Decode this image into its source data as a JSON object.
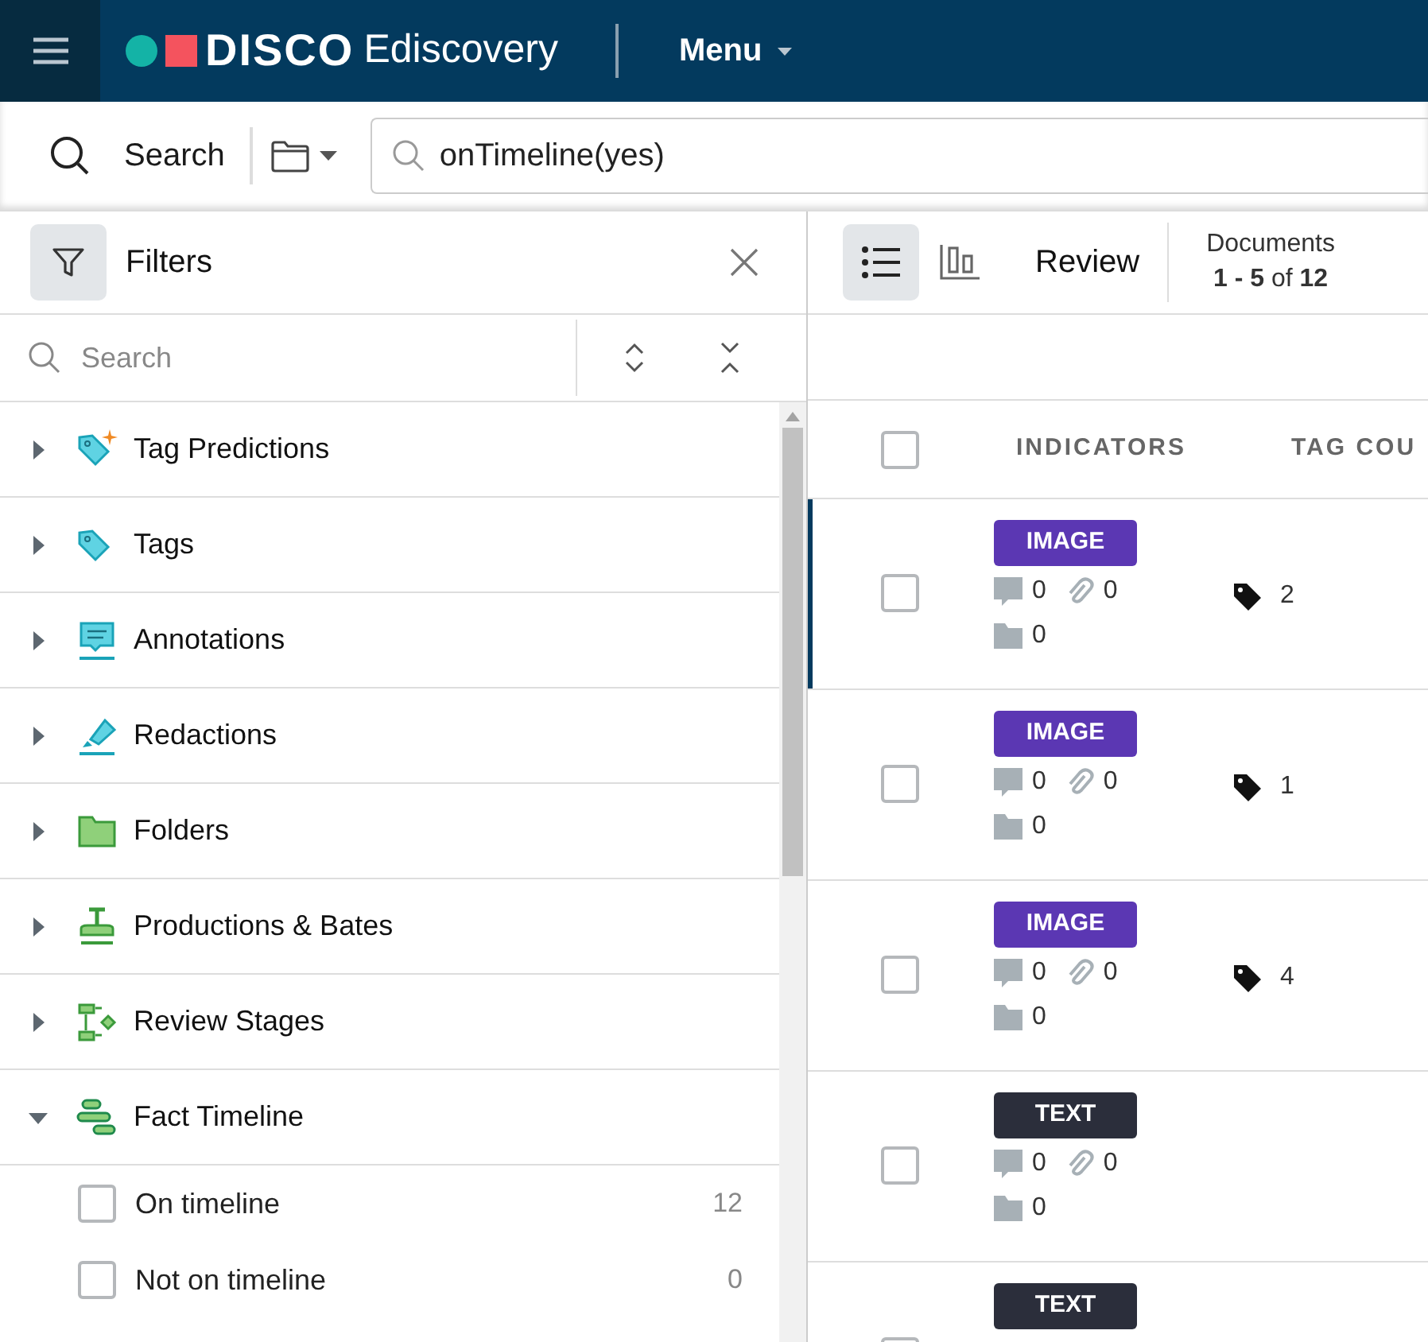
{
  "header": {
    "logo_text": "DISCO",
    "product": "Ediscovery",
    "menu": "Menu"
  },
  "search_bar": {
    "label": "Search",
    "query": "onTimeline(yes)"
  },
  "filters": {
    "title": "Filters",
    "search_placeholder": "Search",
    "categories": [
      {
        "label": "Tag Predictions",
        "expanded": false
      },
      {
        "label": "Tags",
        "expanded": false
      },
      {
        "label": "Annotations",
        "expanded": false
      },
      {
        "label": "Redactions",
        "expanded": false
      },
      {
        "label": "Folders",
        "expanded": false
      },
      {
        "label": "Productions & Bates",
        "expanded": false
      },
      {
        "label": "Review Stages",
        "expanded": false
      },
      {
        "label": "Fact Timeline",
        "expanded": true,
        "children": [
          {
            "label": "On timeline",
            "count": "12",
            "checked": false
          },
          {
            "label": "Not on timeline",
            "count": "0",
            "checked": false
          }
        ]
      }
    ]
  },
  "review": {
    "views": [
      {
        "kind": "list",
        "selected": true
      },
      {
        "kind": "chart",
        "selected": false
      }
    ],
    "title": "Review",
    "documents_label": "Documents",
    "range": "1 - 5",
    "of": "of",
    "total": "12"
  },
  "table": {
    "select_all_checked": false,
    "columns": [
      "INDICATORS",
      "TAG COU"
    ],
    "rows": [
      {
        "type": "IMAGE",
        "kind": "image",
        "checked": false,
        "focused": true,
        "comments": "0",
        "attachments": "0",
        "folders": "0",
        "tag_count": "2"
      },
      {
        "type": "IMAGE",
        "kind": "image",
        "checked": false,
        "focused": false,
        "comments": "0",
        "attachments": "0",
        "folders": "0",
        "tag_count": "1"
      },
      {
        "type": "IMAGE",
        "kind": "image",
        "checked": false,
        "focused": false,
        "comments": "0",
        "attachments": "0",
        "folders": "0",
        "tag_count": "4"
      },
      {
        "type": "TEXT",
        "kind": "text",
        "checked": false,
        "focused": false,
        "comments": "0",
        "attachments": "0",
        "folders": "0"
      },
      {
        "type": "TEXT",
        "kind": "text",
        "checked": false,
        "focused": false
      }
    ]
  }
}
